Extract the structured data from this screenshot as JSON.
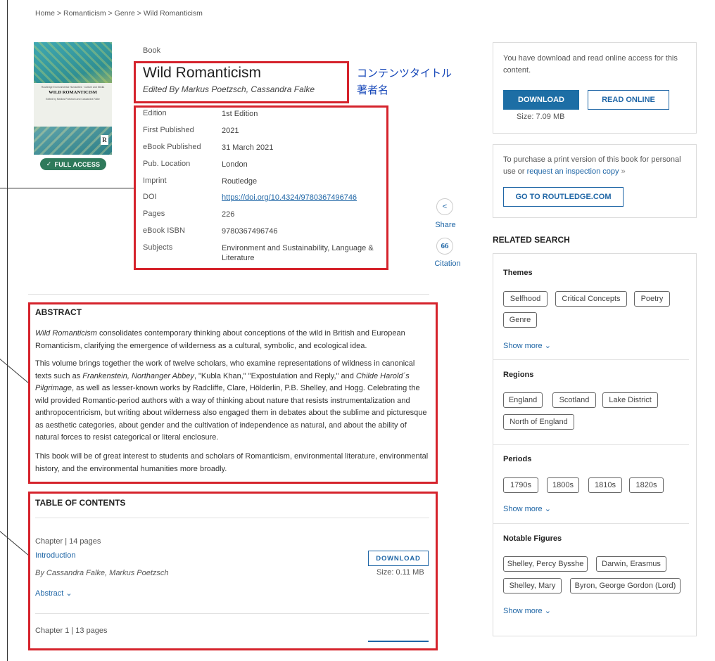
{
  "breadcrumb": {
    "home": "Home",
    "sep": ">",
    "section": "Romanticism",
    "genre": "Genre",
    "current": "Wild Romanticism"
  },
  "book": {
    "type_label": "Book",
    "title": "Wild Romanticism",
    "editors": "Edited By Markus Poetzsch, Cassandra Falke",
    "access_badge": "FULL ACCESS",
    "cover": {
      "series": "Routledge Environmental Humanities · Culture and Media",
      "title": "WILD ROMANTICISM",
      "editors": "Edited by Markus Poetzsch and Cassandra Falke",
      "publisher_logo": "R"
    }
  },
  "annotations": {
    "jp_title": "コンテンツタイトル",
    "jp_author": "著者名"
  },
  "metadata": [
    {
      "label": "Edition",
      "value": "1st Edition"
    },
    {
      "label": "First Published",
      "value": "2021"
    },
    {
      "label": "eBook Published",
      "value": "31 March 2021"
    },
    {
      "label": "Pub. Location",
      "value": "London"
    },
    {
      "label": "Imprint",
      "value": "Routledge"
    },
    {
      "label": "DOI",
      "value": "https://doi.org/10.4324/9780367496746"
    },
    {
      "label": "Pages",
      "value": "226"
    },
    {
      "label": "eBook ISBN",
      "value": "9780367496746"
    },
    {
      "label": "Subjects",
      "value": "Environment and Sustainability, Language & Literature"
    }
  ],
  "actions": {
    "share": "Share",
    "citation": "Citation",
    "citation_glyph": "66"
  },
  "abstract": {
    "heading": "ABSTRACT",
    "p1_em": "Wild Romanticism",
    "p1_rest": " consolidates contemporary thinking about conceptions of the wild in British and European Romanticism, clarifying the emergence of wilderness as a cultural, symbolic, and ecological idea.",
    "p2_a": "This volume brings together the work of twelve scholars, who examine representations of wildness in canonical texts such as ",
    "p2_em1": "Frankenstein, Northanger Abbey",
    "p2_b": ", \"Kubla Khan,\" \"Expostulation and Reply,\" and ",
    "p2_em2": "Childe Harold´s Pilgrimage",
    "p2_c": ", as well as lesser-known works by Radcliffe, Clare, Hölderlin, P.B. Shelley, and Hogg. Celebrating the wild provided Romantic-period authors with a way of thinking about nature that resists instrumentalization and anthropocentricism, but writing about wilderness also engaged them in debates about the sublime and picturesque as aesthetic categories, about gender and the cultivation of independence as natural, and about the ability of natural forces to resist categorical or literal enclosure.",
    "p3": "This book will be of great interest to students and scholars of Romanticism, environmental literature, environmental history, and the environmental humanities more broadly."
  },
  "toc": {
    "heading": "TABLE OF CONTENTS",
    "chapters": [
      {
        "meta": "Chapter | 14 pages",
        "title": "Introduction",
        "authors": "By Cassandra Falke, Markus Poetzsch",
        "download": "DOWNLOAD",
        "size": "Size: 0.11 MB",
        "abstract_toggle": "Abstract"
      },
      {
        "meta": "Chapter 1 | 13 pages"
      }
    ]
  },
  "access_card": {
    "text": "You have download and read online access for this content.",
    "download": "DOWNLOAD",
    "read_online": "READ ONLINE",
    "size": "Size: 7.09 MB"
  },
  "purchase_card": {
    "text": "To purchase a print version of this book for personal use or ",
    "link": "request an inspection copy",
    "link_suffix": "»",
    "button": "GO TO ROUTLEDGE.COM"
  },
  "related": {
    "heading": "RELATED SEARCH",
    "show_more": "Show more",
    "groups": [
      {
        "title": "Themes",
        "tags": [
          "Selfhood",
          "Critical Concepts",
          "Poetry",
          "Genre"
        ]
      },
      {
        "title": "Regions",
        "tags": [
          "England",
          "Scotland",
          "Lake District",
          "North of England"
        ]
      },
      {
        "title": "Periods",
        "tags": [
          "1790s",
          "1800s",
          "1810s",
          "1820s"
        ]
      },
      {
        "title": "Notable Figures",
        "tags": [
          "Shelley, Percy Bysshe",
          "Darwin, Erasmus",
          "Shelley, Mary",
          "Byron, George Gordon (Lord)"
        ]
      }
    ]
  },
  "colors": {
    "accent": "#1d6ea5",
    "link": "#1f66a6",
    "highlight": "#d5232c",
    "badge": "#2f7a5b",
    "annotation": "#1546b8"
  }
}
